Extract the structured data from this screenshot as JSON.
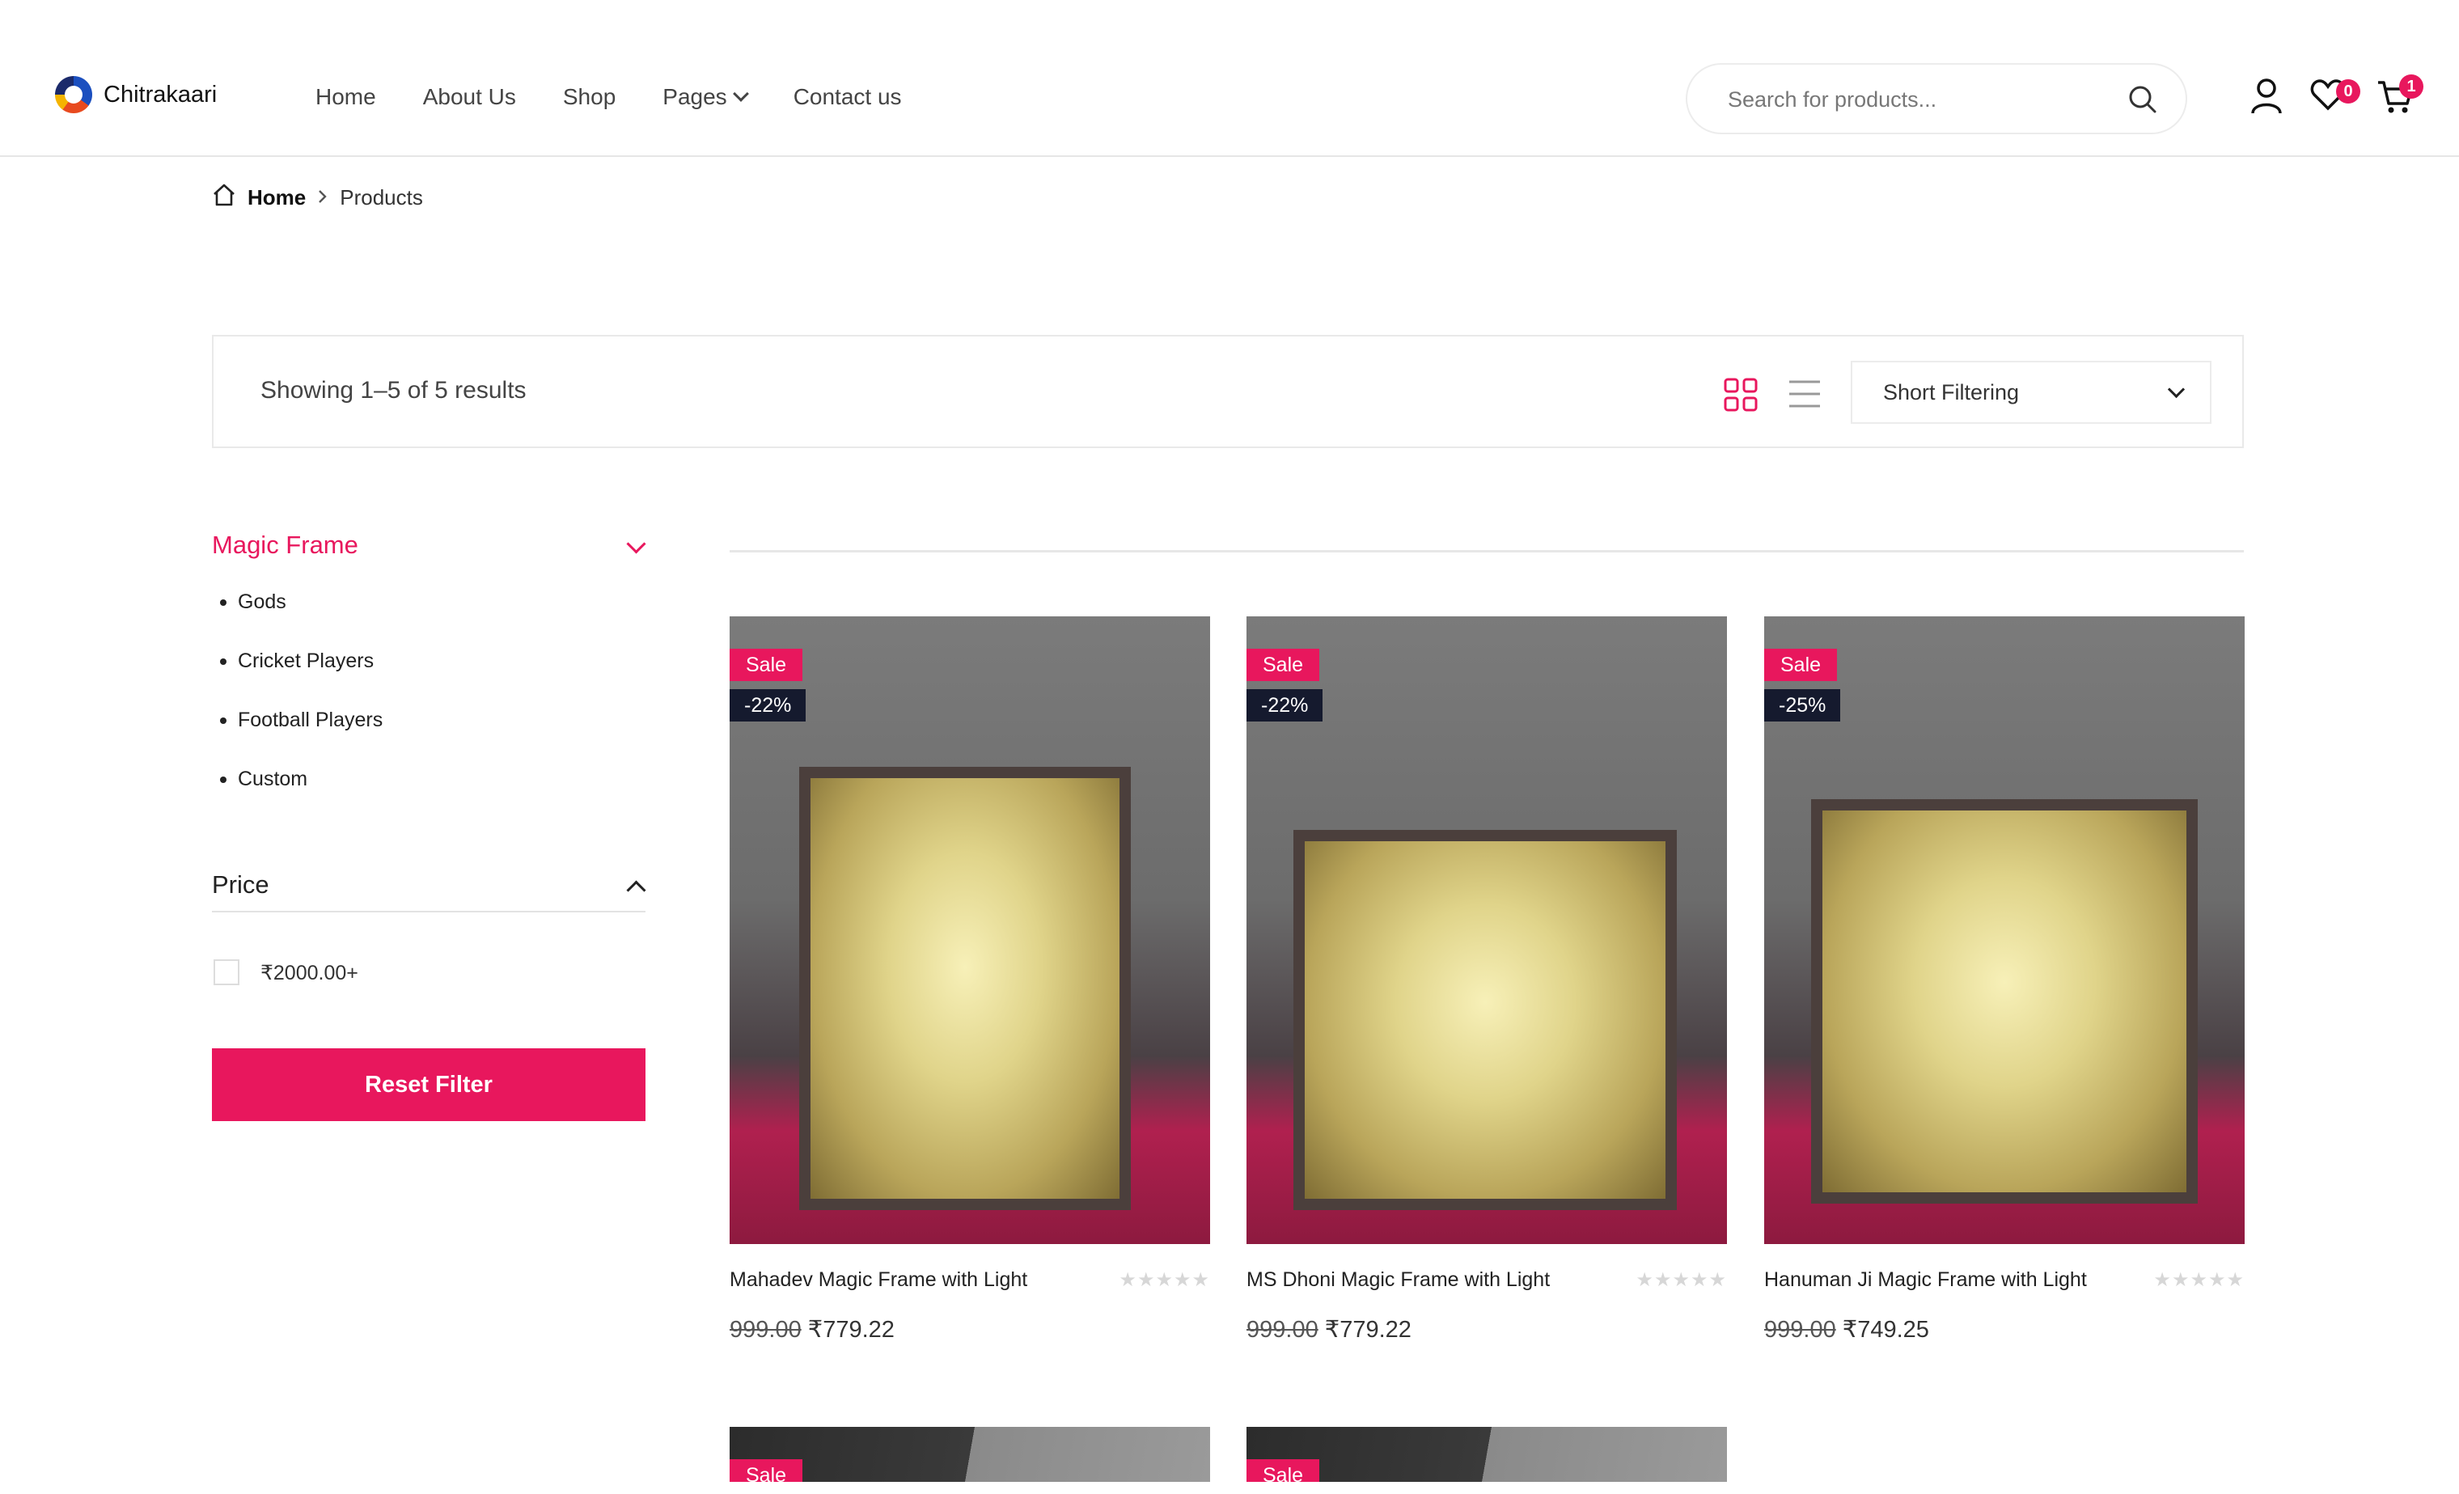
{
  "header": {
    "logo_text": "Chitrakaari",
    "nav": [
      "Home",
      "About Us",
      "Shop",
      "Pages",
      "Contact us"
    ],
    "search_placeholder": "Search for products...",
    "wishlist_count": "0",
    "cart_count": "1"
  },
  "breadcrumb": {
    "home": "Home",
    "current": "Products"
  },
  "toolbar": {
    "results_text": "Showing 1–5 of 5 results",
    "sort_label": "Short Filtering"
  },
  "sidebar": {
    "category_title": "Magic Frame",
    "categories": [
      "Gods",
      "Cricket Players",
      "Football Players",
      "Custom"
    ],
    "price_title": "Price",
    "price_option": "₹2000.00+",
    "reset_label": "Reset Filter"
  },
  "products": [
    {
      "name": "Mahadev Magic Frame with Light",
      "old_price": "999.00",
      "price": "₹779.22",
      "sale": "Sale",
      "discount": "-22%",
      "rating": 0
    },
    {
      "name": "MS Dhoni Magic Frame with Light",
      "old_price": "999.00",
      "price": "₹779.22",
      "sale": "Sale",
      "discount": "-22%",
      "rating": 0
    },
    {
      "name": "Hanuman Ji Magic Frame with Light",
      "old_price": "999.00",
      "price": "₹749.25",
      "sale": "Sale",
      "discount": "-25%",
      "rating": 0
    }
  ],
  "partial_products": [
    {
      "sale": "Sale"
    },
    {
      "sale": "Sale"
    }
  ],
  "colors": {
    "accent": "#e8175d",
    "dark_badge": "#151a2e"
  }
}
